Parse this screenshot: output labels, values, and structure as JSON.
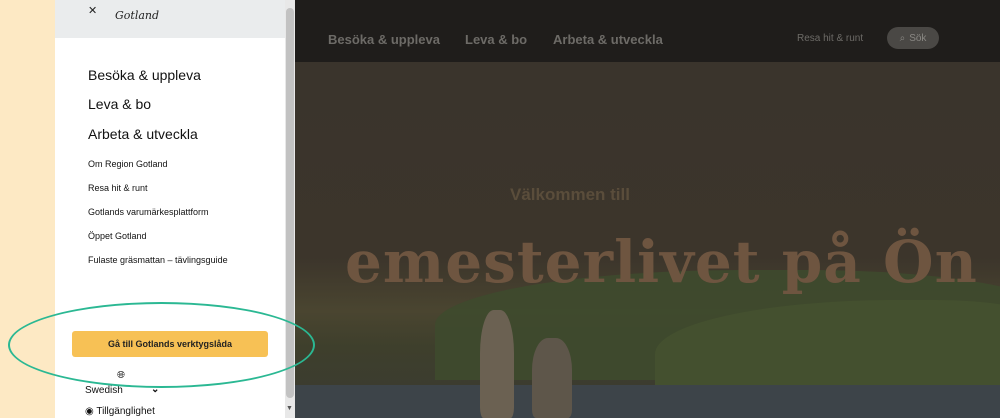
{
  "site": {
    "nav": [
      "Besöka & uppleva",
      "Leva & bo",
      "Arbeta & utveckla"
    ],
    "travel_link": "Resa hit & runt",
    "search_label": "Sök",
    "welcome": "Välkommen till",
    "hero_title": "emesterlivet på Ön"
  },
  "panel": {
    "logo_text": "Gotland",
    "main_items": [
      "Besöka & uppleva",
      "Leva & bo",
      "Arbeta & utveckla"
    ],
    "sub_items": [
      "Om Region Gotland",
      "Resa hit & runt",
      "Gotlands varumärkesplattform",
      "Öppet Gotland",
      "Fulaste gräsmattan – tävlingsguide"
    ],
    "toolbox_button": "Gå till Gotlands verktygslåda",
    "language": "Swedish",
    "accessibility": "Tillgänglighet"
  },
  "colors": {
    "accent_button": "#f7c155",
    "highlight_ellipse": "#2bb893",
    "page_background": "#fde9c4"
  },
  "icons": [
    "search-icon",
    "globe-icon",
    "chevron-down-icon",
    "eye-icon",
    "close-icon"
  ]
}
